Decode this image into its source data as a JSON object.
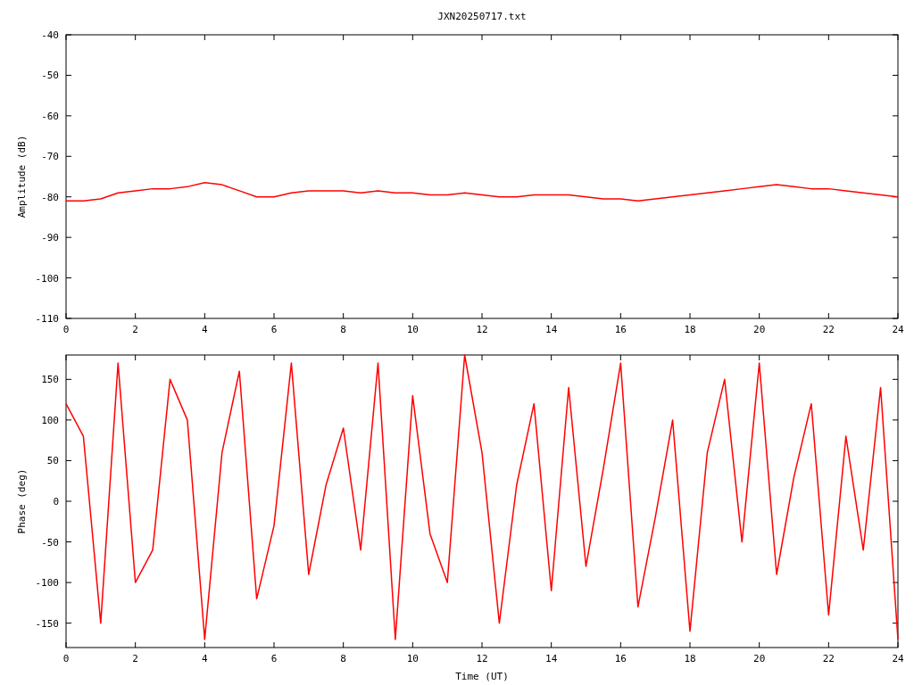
{
  "title": "JXN20250717.txt",
  "charts": [
    {
      "chart_data": {
        "type": "line",
        "ylabel": "Amplitude (dB)",
        "xlim": [
          0,
          24
        ],
        "ylim": [
          -110,
          -40
        ],
        "xticks": [
          0,
          2,
          4,
          6,
          8,
          10,
          12,
          14,
          16,
          18,
          20,
          22,
          24
        ],
        "yticks": [
          -110,
          -100,
          -90,
          -80,
          -70,
          -60,
          -50,
          -40
        ],
        "x": [
          0,
          0.5,
          1,
          1.5,
          2,
          2.5,
          3,
          3.5,
          4,
          4.5,
          5,
          5.5,
          6,
          6.5,
          7,
          7.5,
          8,
          8.5,
          9,
          9.5,
          10,
          10.5,
          11,
          11.5,
          12,
          12.5,
          13,
          13.5,
          14,
          14.5,
          15,
          15.5,
          16,
          16.5,
          17,
          17.5,
          18,
          18.5,
          19,
          19.5,
          20,
          20.5,
          21,
          21.5,
          22,
          22.5,
          23,
          23.5,
          24
        ],
        "series": [
          {
            "color": "#ff0000",
            "values": [
              -81,
              -81,
              -80.5,
              -79,
              -78.5,
              -78,
              -78,
              -77.5,
              -76.5,
              -77,
              -78.5,
              -80,
              -80,
              -79,
              -78.5,
              -78.5,
              -78.5,
              -79,
              -78.5,
              -79,
              -79,
              -79.5,
              -79.5,
              -79,
              -79.5,
              -80,
              -80,
              -79.5,
              -79.5,
              -79.5,
              -80,
              -80.5,
              -80.5,
              -81,
              -80.5,
              -80,
              -79.5,
              -79,
              -78.5,
              -78,
              -77.5,
              -77,
              -77.5,
              -78,
              -78,
              -78.5,
              -79,
              -79.5,
              -80
            ]
          }
        ]
      }
    },
    {
      "chart_data": {
        "type": "line",
        "xlabel": "Time (UT)",
        "ylabel": "Phase (deg)",
        "xlim": [
          0,
          24
        ],
        "ylim": [
          -180,
          180
        ],
        "xticks": [
          0,
          2,
          4,
          6,
          8,
          10,
          12,
          14,
          16,
          18,
          20,
          22,
          24
        ],
        "yticks": [
          -150,
          -100,
          -50,
          0,
          50,
          100,
          150
        ],
        "x": [
          0,
          0.5,
          1,
          1.5,
          2,
          2.5,
          3,
          3.5,
          4,
          4.5,
          5,
          5.5,
          6,
          6.5,
          7,
          7.5,
          8,
          8.5,
          9,
          9.5,
          10,
          10.5,
          11,
          11.5,
          12,
          12.5,
          13,
          13.5,
          14,
          14.5,
          15,
          15.5,
          16,
          16.5,
          17,
          17.5,
          18,
          18.5,
          19,
          19.5,
          20,
          20.5,
          21,
          21.5,
          22,
          22.5,
          23,
          23.5,
          24
        ],
        "series": [
          {
            "color": "#ff0000",
            "values": [
              120,
              80,
              -150,
              170,
              -100,
              -60,
              150,
              100,
              -170,
              60,
              160,
              -120,
              -30,
              170,
              -90,
              20,
              90,
              -60,
              170,
              -170,
              130,
              -40,
              -100,
              180,
              60,
              -150,
              20,
              120,
              -110,
              140,
              -80,
              40,
              170,
              -130,
              -20,
              100,
              -160,
              60,
              150,
              -50,
              170,
              -90,
              30,
              120,
              -140,
              80,
              -60,
              140,
              -170
            ]
          }
        ]
      }
    }
  ]
}
